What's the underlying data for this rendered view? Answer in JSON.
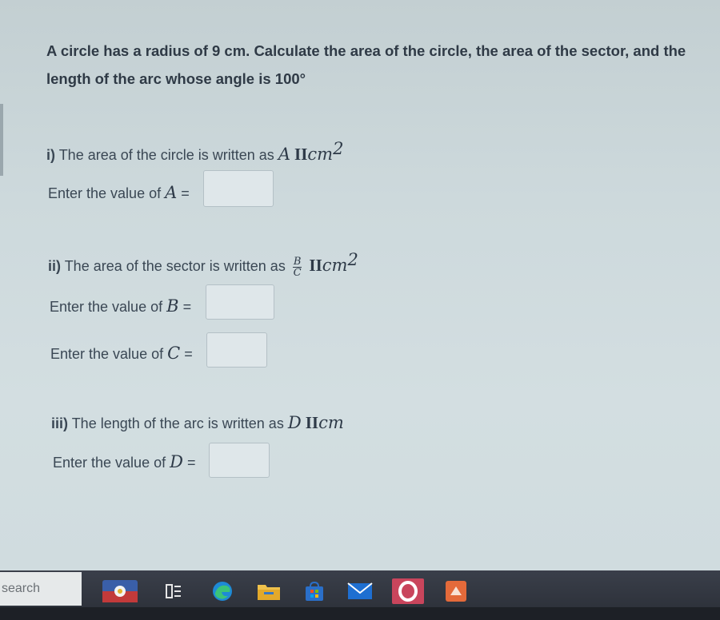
{
  "question": {
    "title": "A circle has a radius of 9 cm. Calculate the area of the circle, the area of the sector, and the length of the arc whose angle is 100°"
  },
  "part1": {
    "num": "i)",
    "text": "The area of the circle is written as",
    "var": "A",
    "pi": "II",
    "unit": "cm",
    "exp": "2",
    "input_label": "Enter the value of",
    "input_var": "A",
    "eq": "="
  },
  "part2": {
    "num": "ii)",
    "text": "The area of the sector is written as",
    "frac_num": "B",
    "frac_den": "C",
    "pi": "II",
    "unit": "cm",
    "exp": "2",
    "input_label_b": "Enter the value of",
    "input_var_b": "B",
    "input_label_c": "Enter the value of",
    "input_var_c": "C",
    "eq": "="
  },
  "part3": {
    "num": "iii)",
    "text": "The length of the arc is written as",
    "var": "D",
    "pi": "II",
    "unit": "cm",
    "input_label": "Enter the value of",
    "input_var": "D",
    "eq": "="
  },
  "inputs": {
    "a_value": "",
    "b_value": "",
    "c_value": "",
    "d_value": ""
  },
  "taskbar": {
    "search_text": "search",
    "icons": [
      "weather-icon",
      "task-view-icon",
      "edge-icon",
      "file-explorer-icon",
      "store-icon",
      "mail-icon",
      "opera-icon",
      "app-icon"
    ]
  },
  "colors": {
    "background": "#cdd9dc",
    "text": "#2f3a46",
    "taskbar": "#2a2e36"
  }
}
